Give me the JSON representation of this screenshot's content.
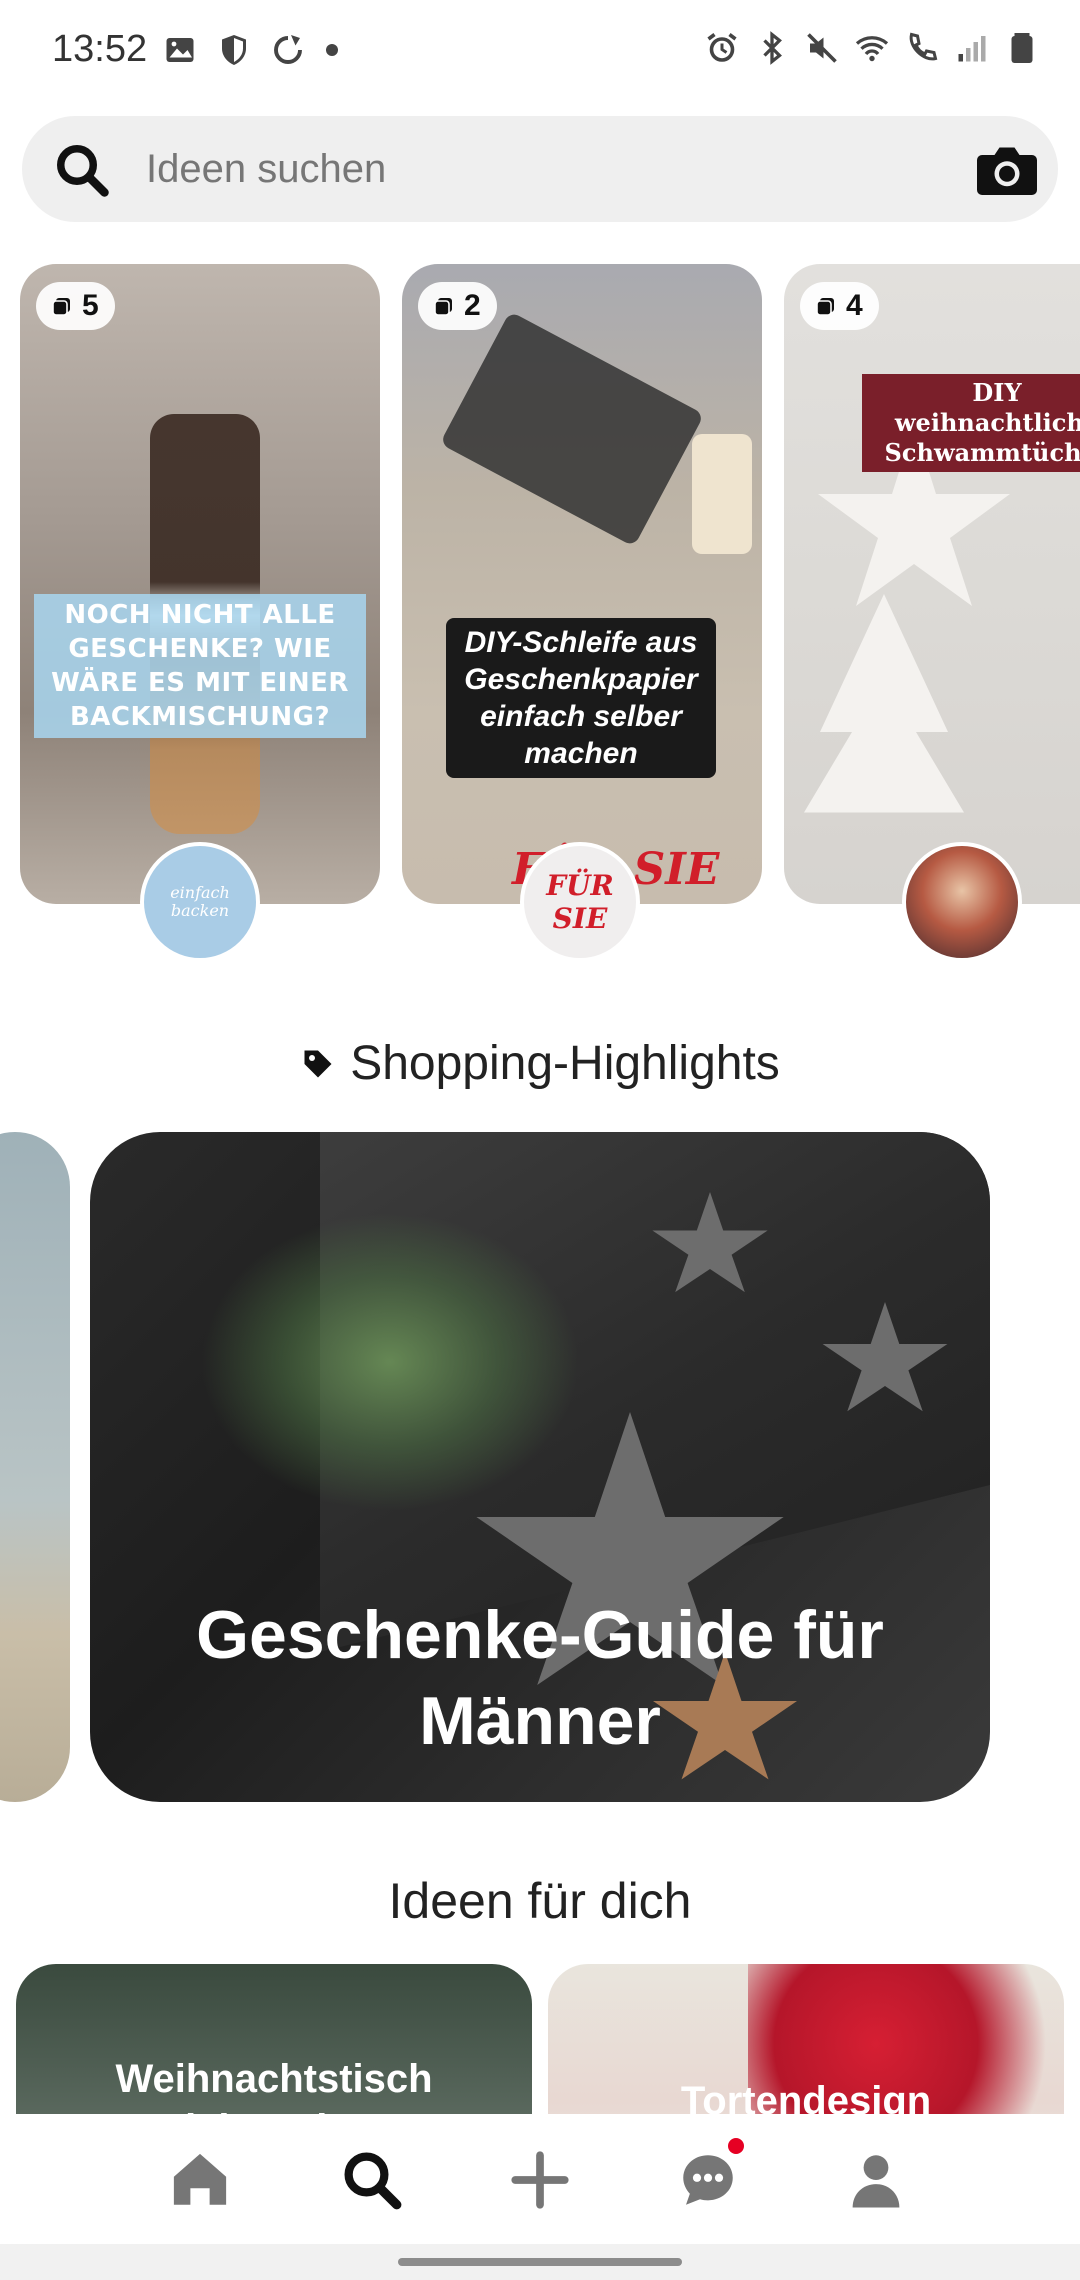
{
  "status_bar": {
    "time": "13:52",
    "left_icons": [
      "gallery-icon",
      "shield-icon",
      "sync-icon",
      "dot-icon"
    ],
    "right_icons": [
      "alarm-icon",
      "bluetooth-icon",
      "mute-icon",
      "wifi-icon",
      "call-icon",
      "signal-icon",
      "battery-icon"
    ]
  },
  "search": {
    "placeholder": "Ideen suchen",
    "value": ""
  },
  "stories": [
    {
      "count": "5",
      "overlay": "NOCH NICHT ALLE GESCHENKE? WIE WÄRE ES MIT EINER BACKMISCHUNG?",
      "avatar_text": "einfach backen"
    },
    {
      "count": "2",
      "overlay": "DIY-Schleife aus Geschenkpapier einfach selber machen",
      "brand": "FÜR SIE",
      "avatar_text": "FÜR SIE"
    },
    {
      "count": "4",
      "overlay": "DIY weihnachtliche Schwammtücher",
      "avatar_text": ""
    }
  ],
  "shopping": {
    "header": "Shopping-Highlights",
    "card_title": "Geschenke-Guide für Männer"
  },
  "ideas": {
    "header": "Ideen für dich",
    "cards": [
      {
        "title": "Weihnachtstisch dekoration"
      },
      {
        "title": "Tortendesign"
      }
    ]
  },
  "nav": {
    "items": [
      "home-icon",
      "search-icon",
      "plus-icon",
      "messages-icon",
      "profile-icon"
    ],
    "active": "search-icon",
    "notification_color": "#e60023"
  }
}
